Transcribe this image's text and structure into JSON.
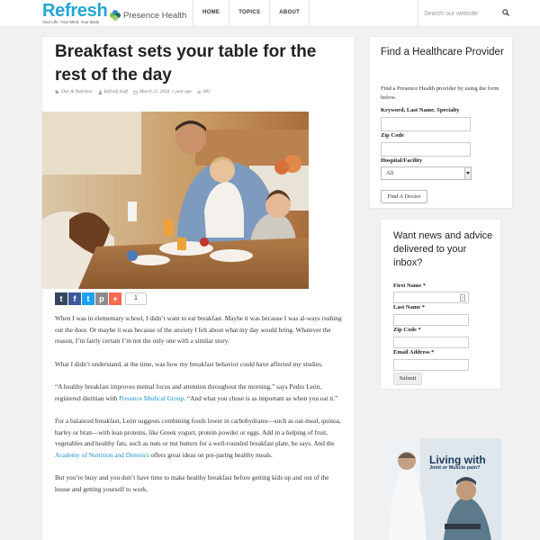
{
  "header": {
    "logo_text": "Refresh",
    "logo_tagline": "Your Life. Your Mind. Your Body.",
    "partner_name": "Presence Health",
    "nav": [
      "HOME",
      "TOPICS",
      "ABOUT"
    ],
    "search_placeholder": "Search our website",
    "search_icon": "search-icon"
  },
  "article": {
    "title": "Breakfast sets your table for the rest of the day",
    "category": "Diet & Nutrition",
    "author": "Refresh Staff",
    "date": "March 21, 2018, 1 year ago",
    "views": "802",
    "share_count": "1",
    "share_buttons": [
      "t",
      "f",
      "t",
      "p",
      "+"
    ],
    "paragraphs": [
      [
        "When I was in elementary school, I didn’t want to eat breakfast. Maybe it was because I was al-ways rushing out the door. Or maybe it was because of the anxiety I felt about what my day would bring. Whatever the reason, I’m fairly certain I’m not the only one with a similar story."
      ],
      [
        "What I didn’t understand, at the time, was how my breakfast behavior could have affected my studies."
      ],
      [
        "“A healthy breakfast improves mental focus and attention throughout the morning,” says Pedro León, registered dietitian with ",
        "Presence Medical Group",
        ". “And what you chose is as important as when you eat it.”"
      ],
      [
        "For a balanced breakfast, León suggests combining foods lower in carbohydrates—such as oat-meal, quinoa, barley or bran—with lean proteins, like Greek yogurt, protein powder or eggs. Add in a helping of fruit, vegetables and healthy fats, such as nuts or nut butters for a well-rounded breakfast plate, he says. And the ",
        "Academy of Nutrition and Dietetics",
        " offers great ideas on pre-paring healthy meals."
      ],
      [
        "But you’re busy and you don’t have time to make healthy breakfast before getting kids up and out of the house and getting yourself to work."
      ]
    ]
  },
  "provider_widget": {
    "title": "Find a Healthcare Provider",
    "intro": "Find a Presence Health provider by using the form below.",
    "label_name": "Keyword, Last Name, Specialty",
    "label_zip": "Zip Code",
    "label_hospital": "Hospital/Facility",
    "hospital_value": "All",
    "button": "Find A Doctor"
  },
  "newsletter": {
    "title": "Want news and advice delivered to your inbox?",
    "label_first": "First Name *",
    "label_last": "Last Name *",
    "label_zip": "Zip Code *",
    "label_email": "Email Address *",
    "button": "Submit"
  },
  "ad": {
    "headline": "Living with",
    "subline": "Joint or Muscle pain?"
  },
  "colors": {
    "brand_blue": "#21a6d6",
    "link_blue": "#1d8fc9"
  }
}
